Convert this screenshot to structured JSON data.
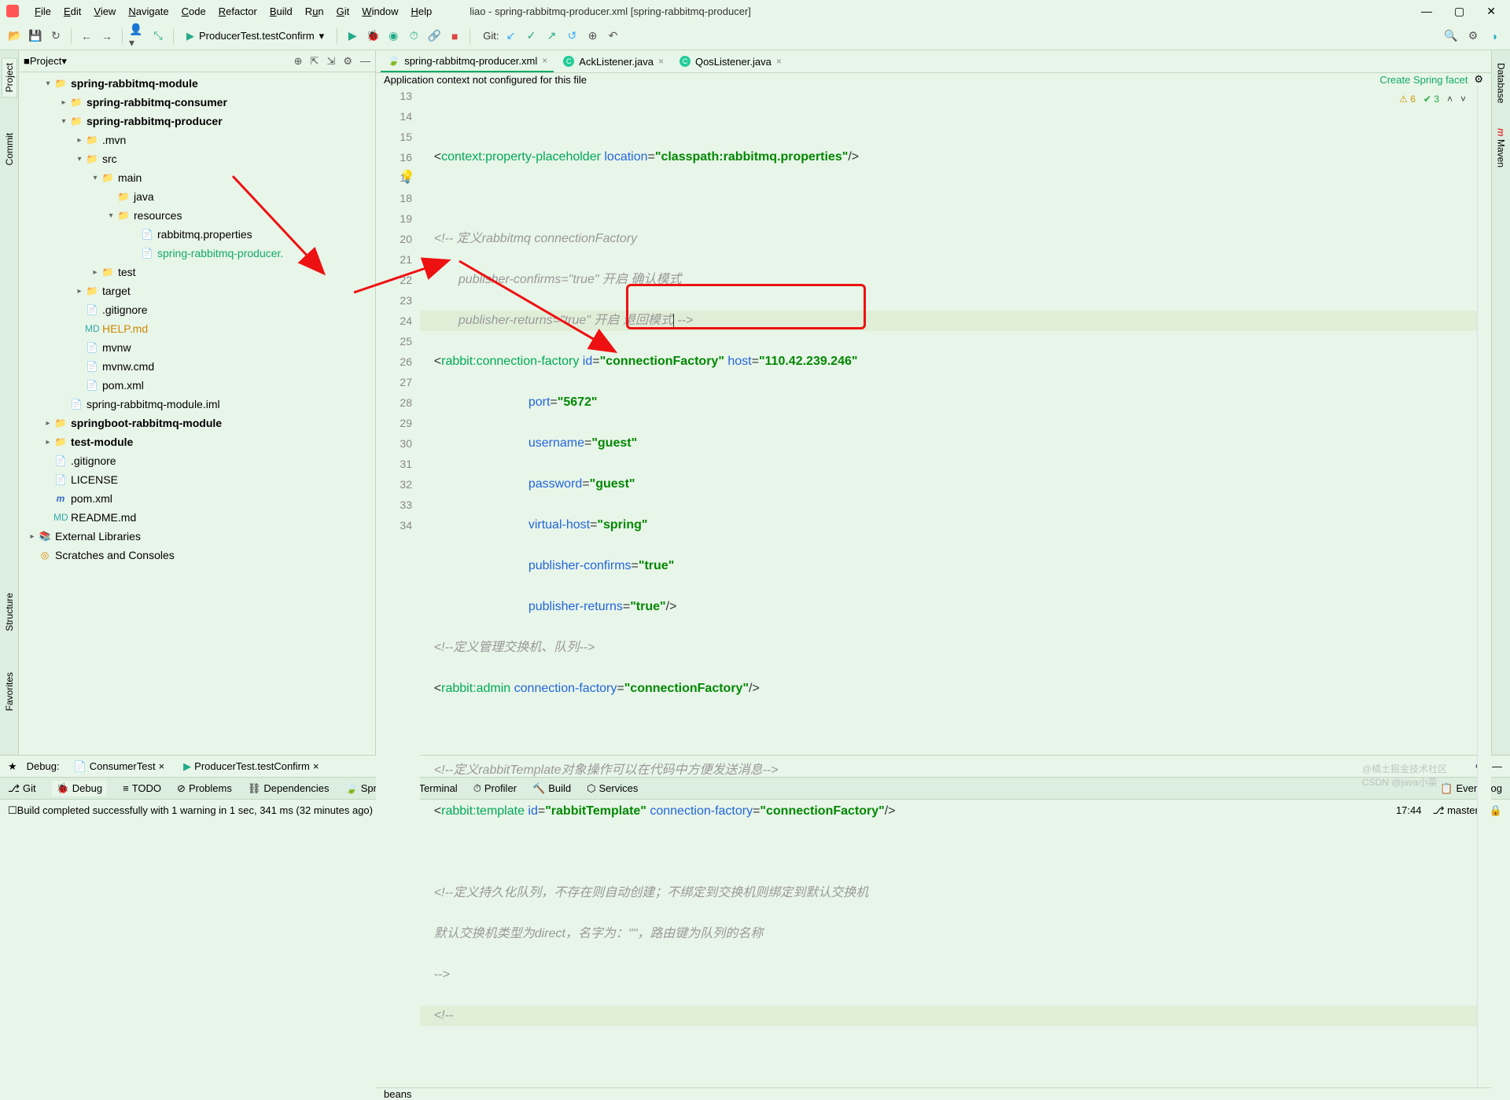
{
  "window": {
    "title": "liao - spring-rabbitmq-producer.xml [spring-rabbitmq-producer]"
  },
  "menu": [
    "File",
    "Edit",
    "View",
    "Navigate",
    "Code",
    "Refactor",
    "Build",
    "Run",
    "Git",
    "Window",
    "Help"
  ],
  "toolbar": {
    "runconfig": "ProducerTest.testConfirm",
    "gitlabel": "Git:"
  },
  "project": {
    "label": "Project",
    "tree": {
      "root": "spring-rabbitmq-module",
      "consumer": "spring-rabbitmq-consumer",
      "producer": "spring-rabbitmq-producer",
      "mvn": ".mvn",
      "src": "src",
      "main": "main",
      "java": "java",
      "resources": "resources",
      "rabbitmq_props": "rabbitmq.properties",
      "producer_xml": "spring-rabbitmq-producer.",
      "test": "test",
      "target": "target",
      "gitignore": ".gitignore",
      "help": "HELP.md",
      "mvnw": "mvnw",
      "mvnwcmd": "mvnw.cmd",
      "pom": "pom.xml",
      "iml": "spring-rabbitmq-module.iml",
      "springboot": "springboot-rabbitmq-module",
      "testmodule": "test-module",
      "license": "LICENSE",
      "m_pom": "pom.xml",
      "readme": "README.md",
      "ext": "External Libraries",
      "scratches": "Scratches and Consoles"
    }
  },
  "tabs": [
    {
      "name": "spring-rabbitmq-producer.xml",
      "active": true,
      "type": "xml"
    },
    {
      "name": "AckListener.java",
      "active": false,
      "type": "java"
    },
    {
      "name": "QosListener.java",
      "active": false,
      "type": "java"
    }
  ],
  "banner": {
    "msg": "Application context not configured for this file",
    "link": "Create Spring facet"
  },
  "problems": {
    "warn": "6",
    "ok": "3"
  },
  "code": {
    "lines": [
      13,
      14,
      15,
      16,
      17,
      18,
      19,
      20,
      21,
      22,
      23,
      24,
      25,
      26,
      27,
      28,
      29,
      30,
      31,
      32,
      33,
      34
    ],
    "l13": "<context:property-placeholder location=\"classpath:rabbitmq.properties\"/>",
    "l15": "<!-- 定义rabbitmq connectionFactory",
    "l16": "       publisher-confirms=\"true\" 开启 确认模式",
    "l17": "       publisher-returns=\"true\" 开启 退回模式-->",
    "l18": "<rabbit:connection-factory id=\"connectionFactory\" host=\"110.42.239.246\"",
    "l19": "                           port=\"5672\"",
    "l20": "                           username=\"guest\"",
    "l21": "                           password=\"guest\"",
    "l22": "                           virtual-host=\"spring\"",
    "l23": "                           publisher-confirms=\"true\"",
    "l24": "                           publisher-returns=\"true\"/>",
    "l25": "<!--定义管理交换机、队列-->",
    "l26": "<rabbit:admin connection-factory=\"connectionFactory\"/>",
    "l28": "<!--定义rabbitTemplate对象操作可以在代码中方便发送消息-->",
    "l29": "<rabbit:template id=\"rabbitTemplate\" connection-factory=\"connectionFactory\"/>",
    "l31": "<!--定义持久化队列，不存在则自动创建；不绑定到交换机则绑定到默认交换机",
    "l32": "默认交换机类型为direct，名字为：\"\"，路由键为队列的名称",
    "l33": "-->",
    "l34": "<!--"
  },
  "breadcrumb": "beans",
  "debug": {
    "label": "Debug:",
    "run1": "ConsumerTest",
    "run2": "ProducerTest.testConfirm"
  },
  "bottom": [
    "Git",
    "Debug",
    "TODO",
    "Problems",
    "Dependencies",
    "Spring",
    "Terminal",
    "Profiler",
    "Build",
    "Services"
  ],
  "bottom_right": "Event Log",
  "status": {
    "msg": "Build completed successfully with 1 warning in 1 sec, 341 ms (32 minutes ago)",
    "time": "17:44",
    "branch": "master"
  },
  "side_left": [
    "Project",
    "Commit",
    "Structure",
    "Favorites"
  ],
  "side_right": [
    "Database",
    "Maven"
  ],
  "watermark1": "@橘土掘金技术社区",
  "watermark2": "CSDN @java小菜"
}
